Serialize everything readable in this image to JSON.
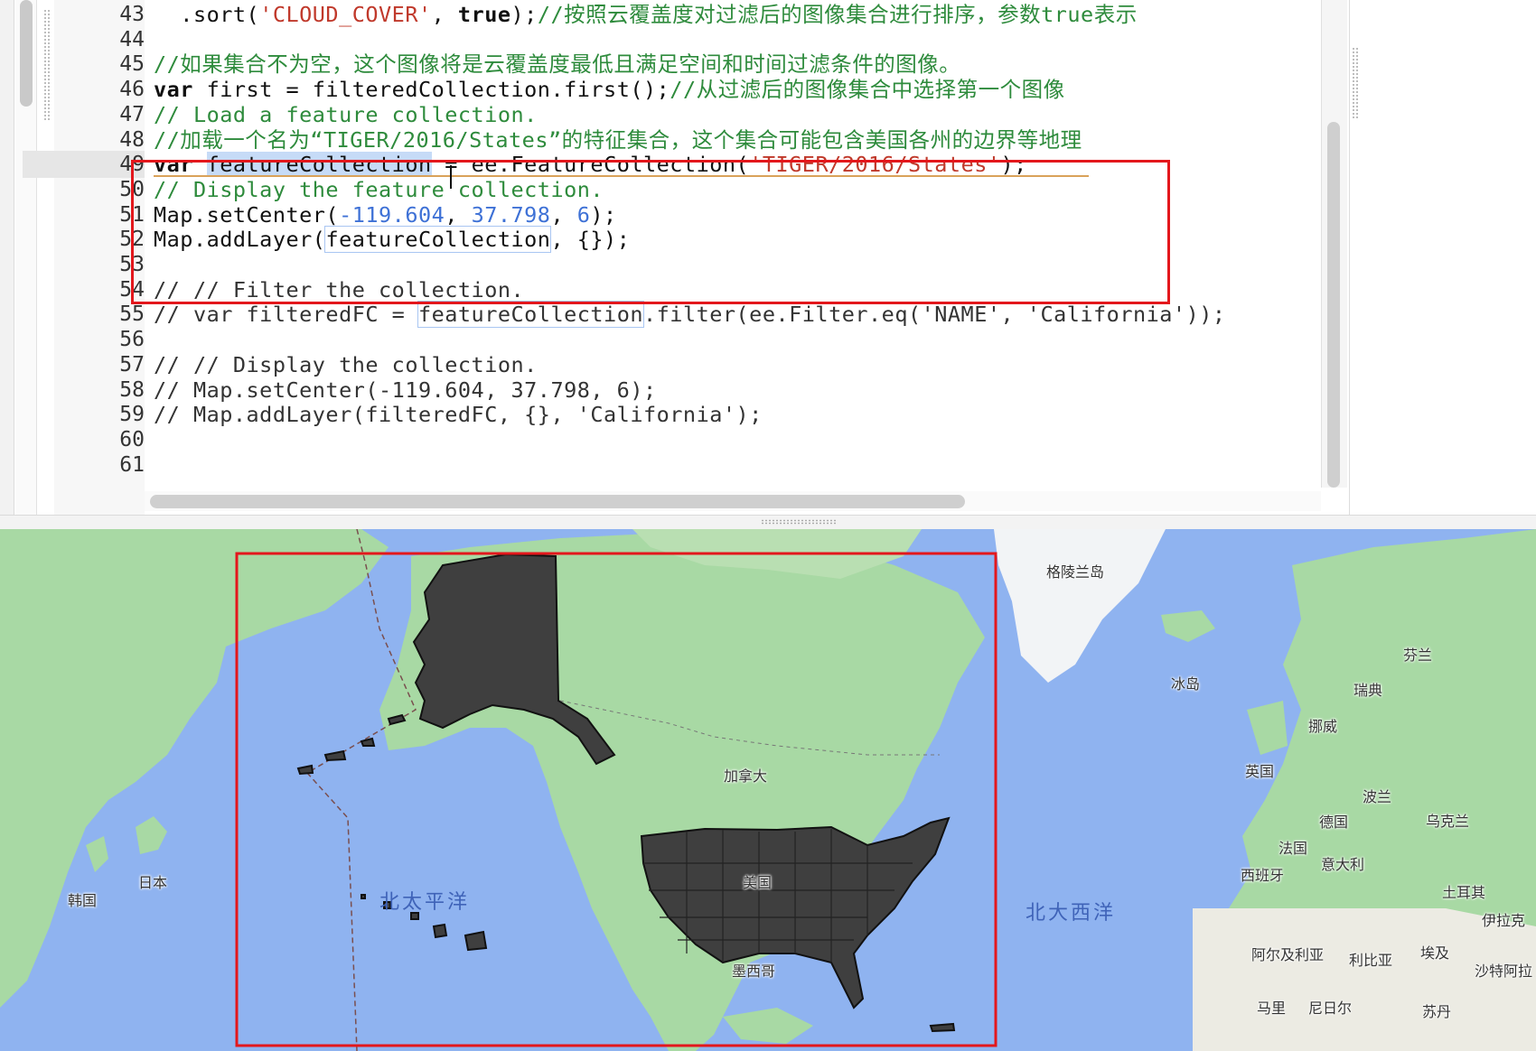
{
  "editor": {
    "lines": [
      {
        "num": "43",
        "parts": [
          [
            "pl",
            "  .sort("
          ],
          [
            "str",
            "'CLOUD_COVER'"
          ],
          [
            "pl",
            ", "
          ],
          [
            "kw",
            "true"
          ],
          [
            "pl",
            ");"
          ],
          [
            "cm",
            "//按照云覆盖度对过滤后的图像集合进行排序，参数true表示"
          ]
        ]
      },
      {
        "num": "44",
        "parts": []
      },
      {
        "num": "45",
        "parts": [
          [
            "cm",
            "//如果集合不为空，这个图像将是云覆盖度最低且满足空间和时间过滤条件的图像。"
          ]
        ]
      },
      {
        "num": "46",
        "parts": [
          [
            "kw",
            "var"
          ],
          [
            "pl",
            " first = filteredCollection.first();"
          ],
          [
            "cm",
            "//从过滤后的图像集合中选择第一个图像"
          ]
        ]
      },
      {
        "num": "47",
        "parts": [
          [
            "cm",
            "// Load a feature collection."
          ]
        ]
      },
      {
        "num": "48",
        "parts": [
          [
            "cm",
            "//加载一个名为“TIGER/2016/States”的特征集合，这个集合可能包含美国各州的边界等地理"
          ]
        ]
      },
      {
        "num": "49",
        "parts": [
          [
            "kw",
            "var"
          ],
          [
            "pl",
            " "
          ],
          [
            "sel",
            "featureCollection"
          ],
          [
            "pl",
            " = ee.FeatureCollection("
          ],
          [
            "str",
            "'TIGER/2016/States'"
          ],
          [
            "pl",
            ");"
          ]
        ]
      },
      {
        "num": "50",
        "parts": [
          [
            "cm",
            "// Display the feature collection."
          ]
        ]
      },
      {
        "num": "51",
        "parts": [
          [
            "pl",
            "Map.setCenter("
          ],
          [
            "num",
            "-119.604"
          ],
          [
            "pl",
            ", "
          ],
          [
            "num",
            "37.798"
          ],
          [
            "pl",
            ", "
          ],
          [
            "num",
            "6"
          ],
          [
            "pl",
            ");"
          ]
        ]
      },
      {
        "num": "52",
        "parts": [
          [
            "pl",
            "Map.addLayer("
          ],
          [
            "box",
            "featureCollection"
          ],
          [
            "pl",
            ", {});"
          ]
        ]
      },
      {
        "num": "53",
        "parts": []
      },
      {
        "num": "54",
        "parts": [
          [
            "cmg",
            "// // Filter the collection."
          ]
        ]
      },
      {
        "num": "55",
        "parts": [
          [
            "cmg",
            "// var filteredFC = "
          ],
          [
            "boxg",
            "featureCollection"
          ],
          [
            "cmg",
            ".filter(ee.Filter.eq('NAME', 'California'));"
          ]
        ]
      },
      {
        "num": "56",
        "parts": []
      },
      {
        "num": "57",
        "parts": [
          [
            "cmg",
            "// // Display the collection."
          ]
        ]
      },
      {
        "num": "58",
        "parts": [
          [
            "cmg",
            "// Map.setCenter(-119.604, 37.798, 6);"
          ]
        ]
      },
      {
        "num": "59",
        "parts": [
          [
            "cmg",
            "// Map.addLayer(filteredFC, {}, 'California');"
          ]
        ]
      },
      {
        "num": "60",
        "parts": []
      },
      {
        "num": "61",
        "parts": []
      }
    ],
    "active_line": "49"
  },
  "map": {
    "labels": {
      "greenland": "格陵兰岛",
      "iceland": "冰岛",
      "finland": "芬兰",
      "sweden": "瑞典",
      "norway": "挪威",
      "uk": "英国",
      "poland": "波兰",
      "germany": "德国",
      "ukraine": "乌克兰",
      "france": "法国",
      "italy": "意大利",
      "spain": "西班牙",
      "turkey": "土耳其",
      "iran": "伊拉克",
      "algeria": "阿尔及利亚",
      "libya": "利比亚",
      "egypt": "埃及",
      "saudi": "沙特阿拉",
      "mali": "马里",
      "niger": "尼日尔",
      "sudan": "苏丹",
      "canada": "加拿大",
      "usa": "美国",
      "mexico": "墨西哥",
      "japan": "日本",
      "korea": "韩国",
      "north_pacific": "北太平洋",
      "north_atlantic": "北大西洋"
    },
    "colors": {
      "ocean": "#8fb3f0",
      "land": "#a8d9a4",
      "feature_fill": "#3f3f3f",
      "annotation_red": "#e3171c"
    }
  }
}
